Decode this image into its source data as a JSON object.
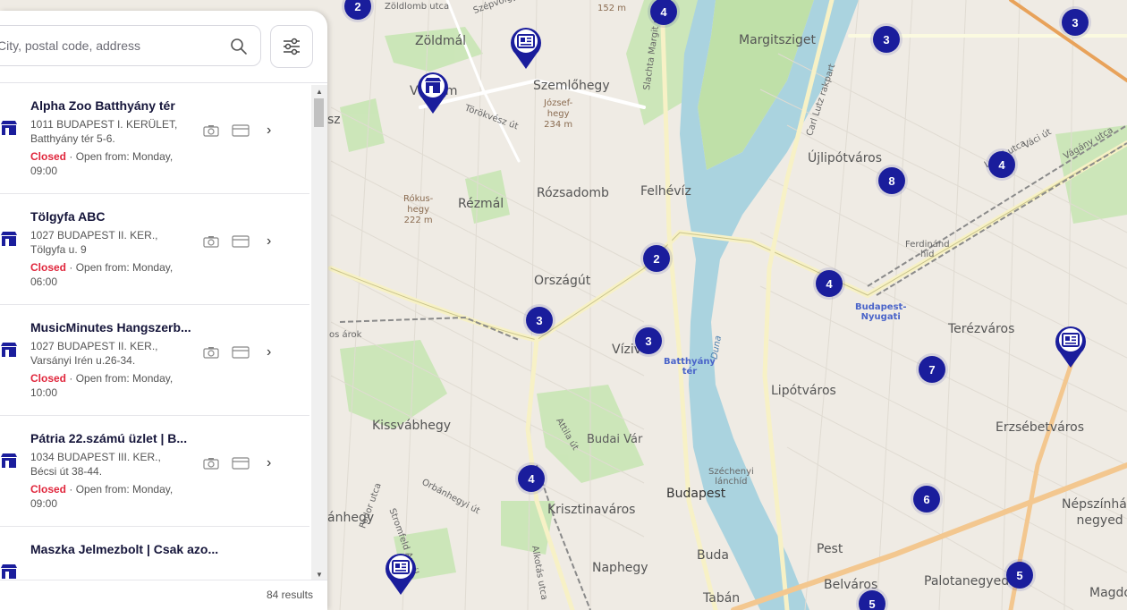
{
  "search": {
    "placeholder": "City, postal code, address"
  },
  "filter_button": {
    "icon": "sliders-icon"
  },
  "stores": [
    {
      "name": "Alpha Zoo Batthyány tér",
      "address_line1": "1011 BUDAPEST I. KERÜLET,",
      "address_line2": "Batthyány tér 5-6.",
      "status": "Closed",
      "open_info": "· Open from: Monday, 09:00"
    },
    {
      "name": "Tölgyfa ABC",
      "address_line1": "1027 BUDAPEST II. KER.,",
      "address_line2": "Tölgyfa u. 9",
      "status": "Closed",
      "open_info": "· Open from: Monday, 06:00"
    },
    {
      "name": "MusicMinutes Hangszerb...",
      "address_line1": "1027 BUDAPEST II. KER.,",
      "address_line2": "Varsányi Irén u.26-34.",
      "status": "Closed",
      "open_info": "· Open from: Monday, 10:00"
    },
    {
      "name": "Pátria 22.számú üzlet | B...",
      "address_line1": "1034 BUDAPEST III. KER.,",
      "address_line2": "Bécsi út 38-44.",
      "status": "Closed",
      "open_info": "· Open from: Monday, 09:00"
    },
    {
      "name": "Maszka Jelmezbolt | Csak azo...",
      "address_line1": "",
      "address_line2": "",
      "status": "",
      "open_info": ""
    }
  ],
  "results_count": "84 results",
  "clusters": [
    "2",
    "4",
    "3",
    "3",
    "4",
    "8",
    "2",
    "4",
    "3",
    "3",
    "7",
    "4",
    "6",
    "5",
    "5"
  ],
  "map_labels": {
    "margitsziget": "Margitsziget",
    "zoldmal": "Zöldmál",
    "szemlohegy": "Szemlőhegy",
    "jozsefhegy": "József-\nhegy\n234 m",
    "ujlipotvaros": "Újlipótváros",
    "felheviz": "Felhévíz",
    "rozsadomb": "Rózsadomb",
    "rezmal": "Rézmál",
    "rokushegy": "Rókus-\nhegy\n222 m",
    "orszagut": "Országút",
    "viziv": "Víziv",
    "batthyany": "Batthyány\ntér",
    "lipotvaros": "Lipótváros",
    "terezvaros": "Terézváros",
    "erzsebetvaros": "Erzsébetváros",
    "kissvabhegy": "Kissvábhegy",
    "budaivar": "Budai Vár",
    "krisztinavaros": "Krisztinaváros",
    "budapest": "Budapest",
    "szechenyi": "Széchenyi\nlánchíd",
    "nepszinhaz": "Népszínház-\nnegyed",
    "naphegy": "Naphegy",
    "buda": "Buda",
    "pest": "Pest",
    "belvaros": "Belváros",
    "palotanegyed": "Palotanegyed",
    "taban": "Tabán",
    "nyugati": "Budapest-\nNyugati",
    "ferdinand": "Ferdinánd\nhíd",
    "duna": "Duna",
    "margit_rakpart": "Slachta Margit rakpart",
    "carl_lutz": "Carl Lutz rakpart",
    "lehel": "Lehel utca",
    "vaci": "Váci út",
    "vagany": "Vágány utca",
    "torokvesz": "Törökvész út",
    "zoldlomb": "Zöldlomb utca",
    "attila": "Attila út",
    "orbanhegyi": "Orbánhegyi út",
    "stromfeld": "Stromfeld Aurél",
    "alkotas": "Alkotás utca",
    "aroktext": "os árok",
    "sz": "sz",
    "anhegy": "ánhegy",
    "magdo": "Magdo",
    "height152": "152 m",
    "szepvolgyi": "Szépvölgyi",
    "fodor": "Fodor utca",
    "vom": "V    lom"
  }
}
